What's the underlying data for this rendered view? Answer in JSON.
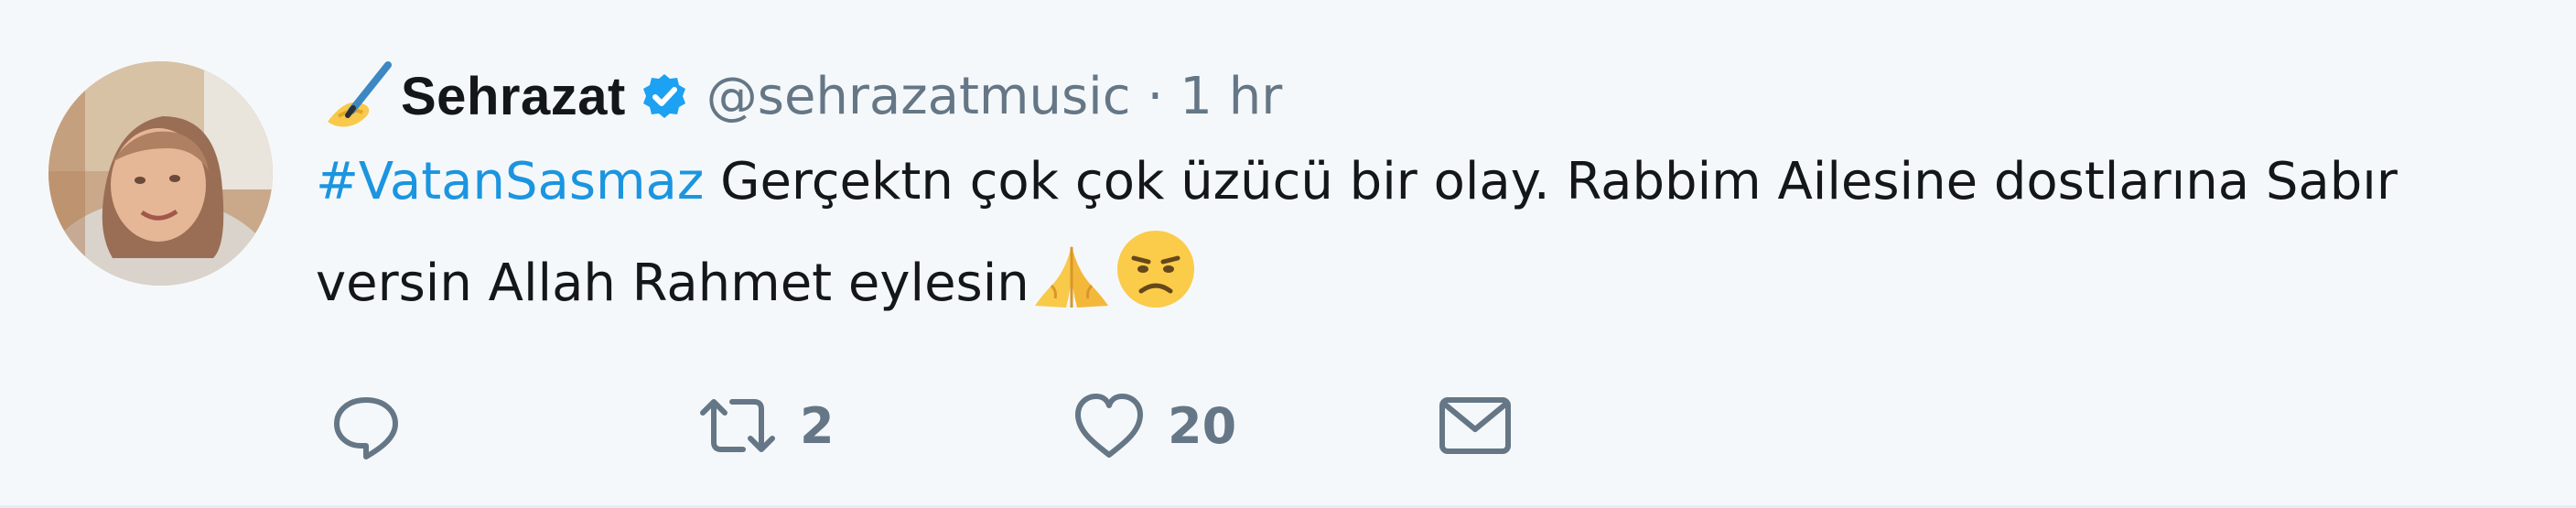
{
  "tweet": {
    "author": {
      "name": "Sehrazat",
      "name_prefix_icon": "writing-hand-emoji",
      "verified_icon": "verified-badge-icon",
      "handle": "@sehrazatmusic",
      "separator": "·",
      "time": "1 hr"
    },
    "text": {
      "hashtag": "#VatanSasmaz",
      "body": " Gerçektn çok çok üzücü bir olay. Rabbim Ailesine dostlarına Sabır versin Allah Rahmet eylesin",
      "emojis": [
        "folded-hands-emoji",
        "disappointed-face-emoji"
      ]
    },
    "actions": {
      "reply_icon": "reply-icon",
      "retweet_icon": "retweet-icon",
      "retweet_count": "2",
      "like_icon": "heart-icon",
      "like_count": "20",
      "dm_icon": "envelope-icon"
    },
    "colors": {
      "background": "#f5f8fa",
      "text": "#14171a",
      "muted": "#657786",
      "link": "#1b95e0",
      "verified": "#1da1f2"
    }
  }
}
